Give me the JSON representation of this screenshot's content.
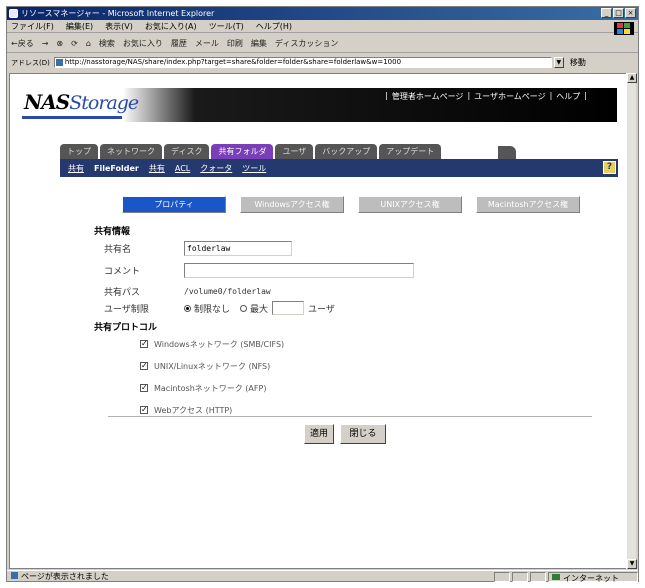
{
  "window": {
    "title": "リソースマネージャー - Microsoft Internet Explorer",
    "controls": [
      "_",
      "□",
      "×"
    ]
  },
  "menu": [
    "ファイル(F)",
    "編集(E)",
    "表示(V)",
    "お気に入り(A)",
    "ツール(T)",
    "ヘルプ(H)"
  ],
  "toolbar": {
    "back": "←戻る",
    "forward": "→",
    "stop": "⊗",
    "refresh": "⟳",
    "home": "⌂",
    "search": "検索",
    "favorites": "お気に入り",
    "history": "履歴",
    "mail": "メール",
    "print": "印刷",
    "edit": "編集",
    "discuss": "ディスカッション"
  },
  "address": {
    "label": "アドレス(D)",
    "url": "http://nasstorage/NAS/share/index.php?target=share&folder=folder&share=folderlaw&w=1000",
    "go": "移動"
  },
  "header": {
    "logo_nas": "NAS",
    "logo_storage": "torage",
    "links": [
      "管理者ホームページ",
      "ユーザホームページ",
      "ヘルプ"
    ]
  },
  "main_tabs": [
    "トップ",
    "ネットワーク",
    "ディスク",
    "共有フォルダ",
    "ユーザ",
    "バックアップ",
    "アップデート"
  ],
  "sub_nav": {
    "items": [
      "共有",
      "FileFolder",
      "共有",
      "ACL",
      "クォータ",
      "ツール"
    ],
    "current_index": 1,
    "help": "?"
  },
  "prop_tabs": [
    "プロパティ",
    "Windowsアクセス権",
    "UNIXアクセス権",
    "Macintoshアクセス権"
  ],
  "form": {
    "section_share": "共有情報",
    "share_name_label": "共有名",
    "share_name_value": "folderlaw",
    "comment_label": "コメント",
    "comment_value": "",
    "path_label": "共有パス",
    "path_value": "/volume0/folderlaw",
    "user_limit_label": "ユーザ制限",
    "no_limit": "制限なし",
    "max_label": "最大",
    "max_value": "",
    "user_unit": "ユーザ",
    "section_protocol": "共有プロトコル",
    "protocols": [
      "Windowsネットワーク (SMB/CIFS)",
      "UNIX/Linuxネットワーク (NFS)",
      "Macintoshネットワーク (AFP)",
      "Webアクセス (HTTP)"
    ]
  },
  "buttons": {
    "apply": "適用",
    "close": "閉じる"
  },
  "status": {
    "text": "ページが表示されました",
    "zone": "インターネット"
  }
}
